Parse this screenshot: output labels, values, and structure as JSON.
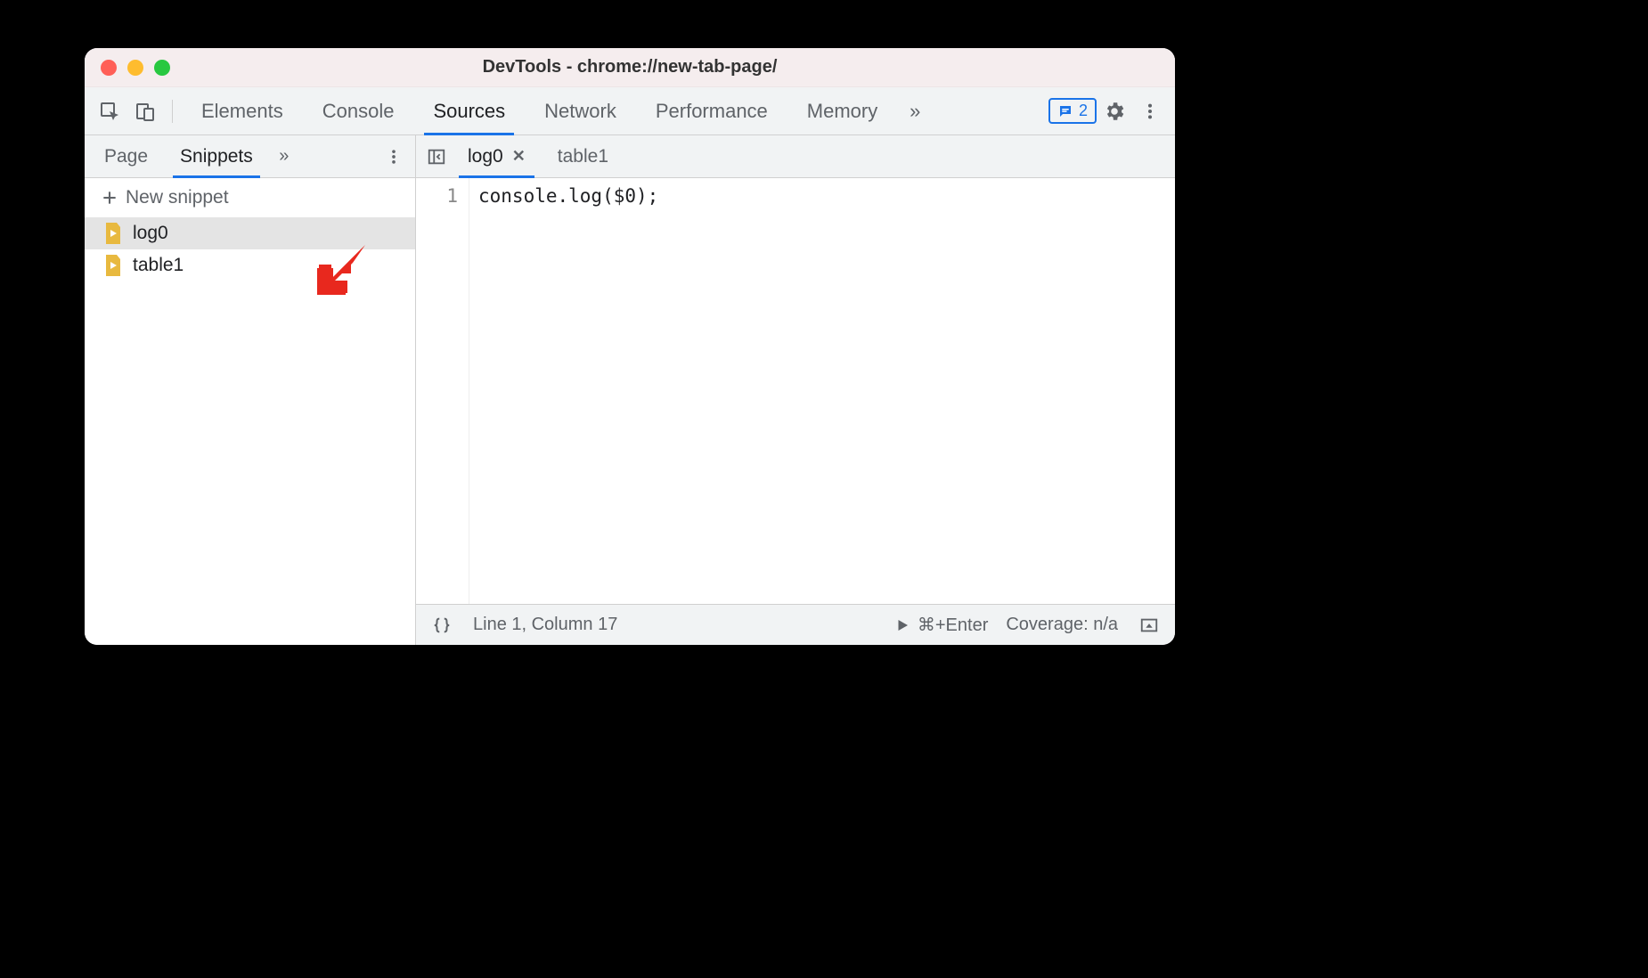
{
  "window": {
    "title": "DevTools - chrome://new-tab-page/"
  },
  "main_tabs": {
    "items": [
      "Elements",
      "Console",
      "Sources",
      "Network",
      "Performance",
      "Memory"
    ],
    "active": "Sources",
    "overflow_glyph": "»",
    "message_count": "2"
  },
  "sidebar": {
    "subtabs": {
      "items": [
        "Page",
        "Snippets"
      ],
      "active": "Snippets",
      "overflow_glyph": "»"
    },
    "new_snippet_label": "New snippet",
    "snippets": [
      {
        "name": "log0",
        "selected": true
      },
      {
        "name": "table1",
        "selected": false
      }
    ]
  },
  "editor": {
    "file_tabs": [
      {
        "name": "log0",
        "active": true,
        "closeable": true
      },
      {
        "name": "table1",
        "active": false,
        "closeable": false
      }
    ],
    "lines": [
      {
        "n": "1",
        "text": "console.log($0);"
      }
    ]
  },
  "status": {
    "cursor": "Line 1, Column 17",
    "run_hint": "⌘+Enter",
    "coverage": "Coverage: n/a"
  }
}
